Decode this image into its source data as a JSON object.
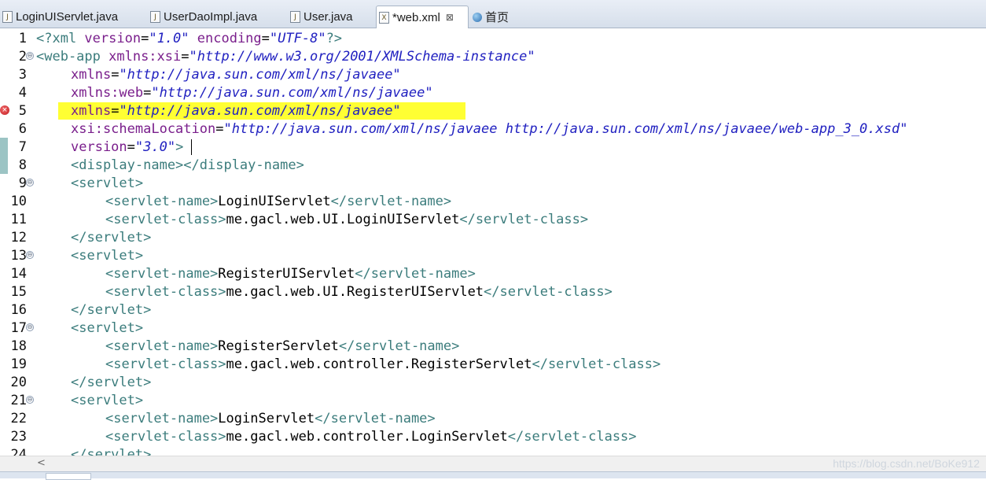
{
  "tabs": [
    {
      "label": "LoginUIServlet.java",
      "icon": "java-file-icon",
      "active": false
    },
    {
      "label": "UserDaoImpl.java",
      "icon": "java-file-icon",
      "active": false
    },
    {
      "label": "User.java",
      "icon": "java-file-icon",
      "active": false
    },
    {
      "label": "*web.xml",
      "icon": "xml-file-icon",
      "active": true,
      "close": "⊠"
    },
    {
      "label": "首页",
      "icon": "globe-icon",
      "active": false
    }
  ],
  "editor": {
    "lines": [
      {
        "n": "1"
      },
      {
        "n": "2"
      },
      {
        "n": "3"
      },
      {
        "n": "4"
      },
      {
        "n": "5"
      },
      {
        "n": "6"
      },
      {
        "n": "7"
      },
      {
        "n": "8"
      },
      {
        "n": "9"
      },
      {
        "n": "10"
      },
      {
        "n": "11"
      },
      {
        "n": "12"
      },
      {
        "n": "13"
      },
      {
        "n": "14"
      },
      {
        "n": "15"
      },
      {
        "n": "16"
      },
      {
        "n": "17"
      },
      {
        "n": "18"
      },
      {
        "n": "19"
      },
      {
        "n": "20"
      },
      {
        "n": "21"
      },
      {
        "n": "22"
      },
      {
        "n": "23"
      },
      {
        "n": "24"
      }
    ],
    "t": {
      "l1_open": "<?xml ",
      "l1_a1": "version",
      "l1_eq1": "=",
      "l1_v1": "\"1.0\"",
      "l1_sp": " ",
      "l1_a2": "encoding",
      "l1_eq2": "=",
      "l1_v2": "\"UTF-8\"",
      "l1_close": "?>",
      "l2_open": "<web-app ",
      "l2_a": "xmlns:xsi",
      "l2_eq": "=",
      "l2_v": "\"http://www.w3.org/2001/XMLSchema-instance\"",
      "l3_a": "xmlns",
      "l3_eq": "=",
      "l3_v": "\"http://java.sun.com/xml/ns/javaee\"",
      "l4_a": "xmlns:web",
      "l4_eq": "=",
      "l4_v": "\"http://java.sun.com/xml/ns/javaee\"",
      "l5_a": "xmlns",
      "l5_eq": "=",
      "l5_v": "\"http://java.sun.com/xml/ns/javaee\"",
      "l6_a": "xsi:schemaLocation",
      "l6_eq": "=",
      "l6_v": "\"http://java.sun.com/xml/ns/javaee http://java.sun.com/xml/ns/javaee/web-app_3_0.xsd\"",
      "l7_a": "version",
      "l7_eq": "=",
      "l7_v": "\"3.0\"",
      "l7_close": ">",
      "l8": "<display-name></display-name>",
      "servlet_open": "<servlet>",
      "servlet_close": "</servlet>",
      "sn_open": "<servlet-name>",
      "sn_close": "</servlet-name>",
      "sc_open": "<servlet-class>",
      "sc_close": "</servlet-class>",
      "l10_text": "LoginUIServlet",
      "l11_text": "me.gacl.web.UI.LoginUIServlet",
      "l14_text": "RegisterUIServlet",
      "l15_text": "me.gacl.web.UI.RegisterUIServlet",
      "l18_text": "RegisterServlet",
      "l19_text": "me.gacl.web.controller.RegisterServlet",
      "l22_text": "LoginServlet",
      "l23_text": "me.gacl.web.controller.LoginServlet",
      "l24_partial": "</servlet>"
    },
    "error_marker": "×",
    "fold_marker": "⊖",
    "colors": {
      "tag": "#3b7c7c",
      "attr": "#7a1f8c",
      "value": "#2020c0",
      "highlight": "#ffff33",
      "error": "#c0191f"
    }
  },
  "scrollbar": {
    "left_arrow": "<"
  },
  "watermark": "https://blog.csdn.net/BoKe912"
}
